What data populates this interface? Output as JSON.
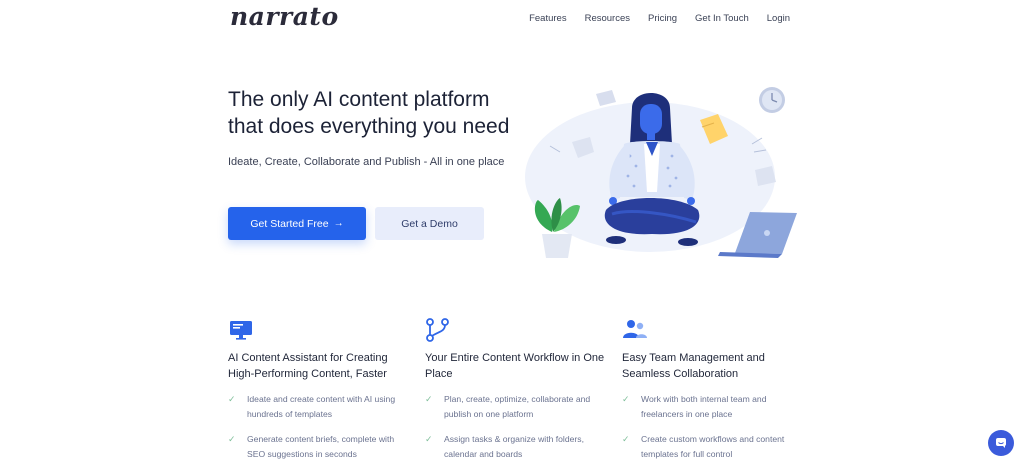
{
  "brand": {
    "logo_text": "narrato"
  },
  "nav": {
    "links": [
      {
        "label": "Features"
      },
      {
        "label": "Resources"
      },
      {
        "label": "Pricing"
      },
      {
        "label": "Get In Touch"
      },
      {
        "label": "Login"
      }
    ]
  },
  "hero": {
    "title": "The only AI content platform that does everything you need",
    "subtitle": "Ideate, Create, Collaborate and Publish - All in one place",
    "primary_button": "Get Started Free",
    "primary_button_icon": "arrow-right-icon",
    "secondary_button": "Get a Demo",
    "illustration": "meditating-woman-illustration"
  },
  "features": [
    {
      "icon": "monitor-icon",
      "title": "AI Content Assistant for Creating High-Performing Content, Faster",
      "items": [
        "Ideate and create content with AI using hundreds of templates",
        "Generate content briefs, complete with SEO suggestions in seconds"
      ]
    },
    {
      "icon": "workflow-icon",
      "title": "Your Entire Content Workflow in One Place",
      "items": [
        "Plan, create, optimize, collaborate and publish on one platform",
        "Assign tasks & organize with folders, calendar and boards"
      ]
    },
    {
      "icon": "team-icon",
      "title": "Easy Team Management and Seamless Collaboration",
      "items": [
        "Work with both internal team and freelancers in one place",
        "Create custom workflows and content templates for full control"
      ]
    }
  ],
  "chat": {
    "icon": "chat-bubble-icon"
  },
  "colors": {
    "primary": "#2563eb",
    "secondary_bg": "#e8edfb",
    "check": "#7fbf9a",
    "chat": "#3b5bdb"
  }
}
